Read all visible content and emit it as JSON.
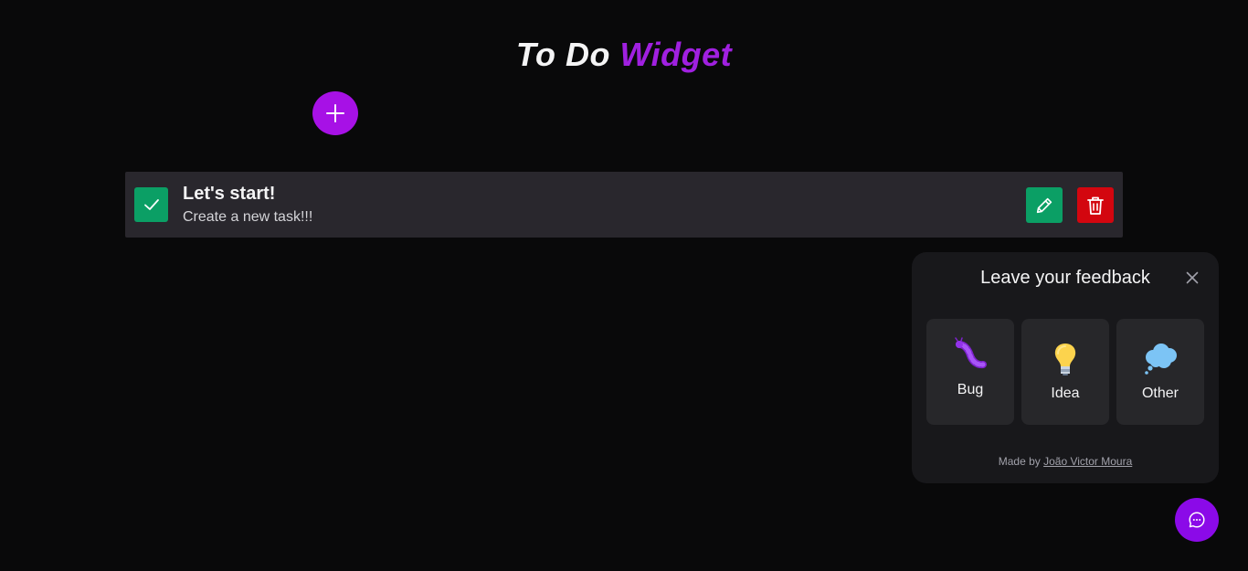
{
  "header": {
    "title_part1": "To Do",
    "title_part2": "Widget"
  },
  "colors": {
    "background": "#09090a",
    "accent": "#a711e6",
    "success": "#0b9f65",
    "danger": "#d3060f",
    "card": "#29272d",
    "panel": "#18181b"
  },
  "task": {
    "title": "Let's start!",
    "description": "Create a new task!!!",
    "icons": {
      "check": "check-icon",
      "edit": "pencil-icon",
      "delete": "trash-icon"
    }
  },
  "add_button": {
    "icon": "plus-icon"
  },
  "feedback": {
    "title": "Leave your feedback",
    "close_icon": "close-icon",
    "options": [
      {
        "label": "Bug",
        "icon": "bug-icon"
      },
      {
        "label": "Idea",
        "icon": "lightbulb-icon"
      },
      {
        "label": "Other",
        "icon": "thought-bubble-icon"
      }
    ],
    "footer_prefix": "Made by",
    "footer_author": "João Victor Moura"
  },
  "chat_button": {
    "icon": "chat-icon"
  }
}
